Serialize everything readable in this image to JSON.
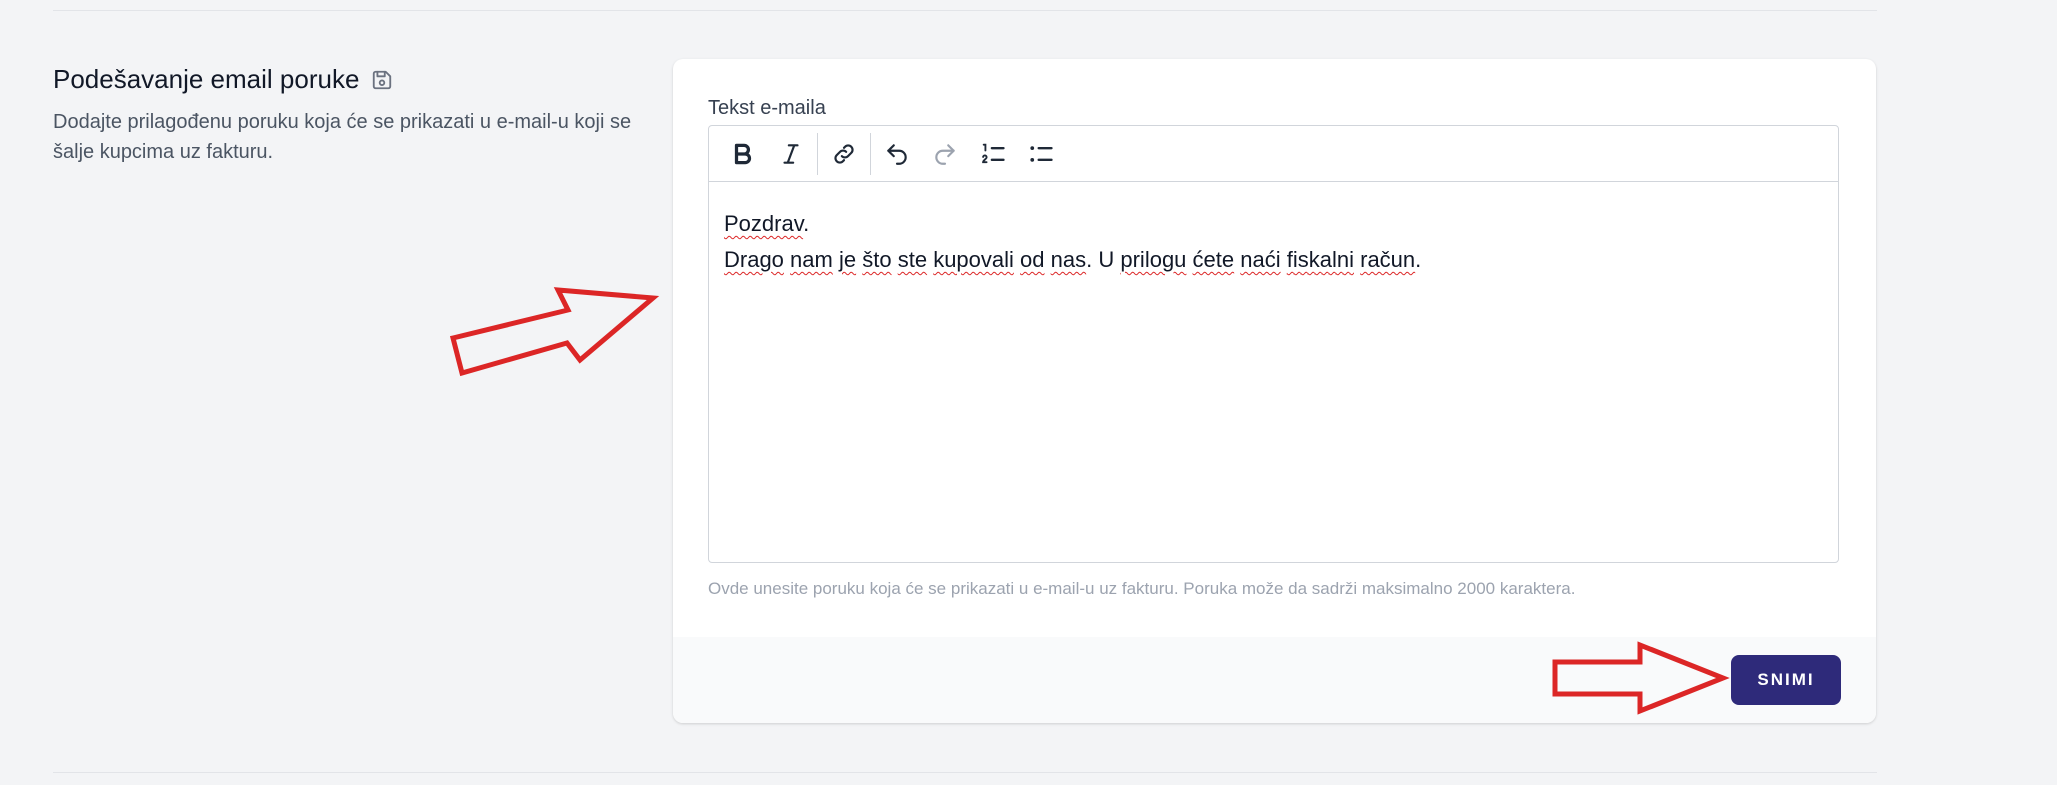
{
  "section": {
    "title": "Podešavanje email poruke",
    "title_icon": "save-icon",
    "description": "Dodajte prilagođenu poruku koja će se prikazati u e-mail-u koji se šalje kupcima uz fakturu."
  },
  "editor": {
    "label": "Tekst e-maila",
    "toolbar": [
      "bold-icon",
      "italic-icon",
      "link-icon",
      "undo-icon",
      "redo-icon",
      "ordered-list-icon",
      "bullet-list-icon"
    ],
    "line1_words": [
      "Pozdrav",
      "."
    ],
    "line2_words": [
      "Drago",
      "nam",
      "je",
      "što",
      "ste",
      "kupovali",
      "od",
      "nas",
      ". U",
      "prilogu",
      "ćete",
      "naći",
      "fiskalni",
      "račun",
      "."
    ],
    "hint": "Ovde unesite poruku koja će se prikazati u e-mail-u uz fakturu. Poruka može da sadrži maksimalno 2000 karaktera."
  },
  "footer": {
    "save_label": "SNIMI"
  },
  "colors": {
    "accent": "#2e2a7a",
    "annotation_arrow": "#dc2626"
  }
}
